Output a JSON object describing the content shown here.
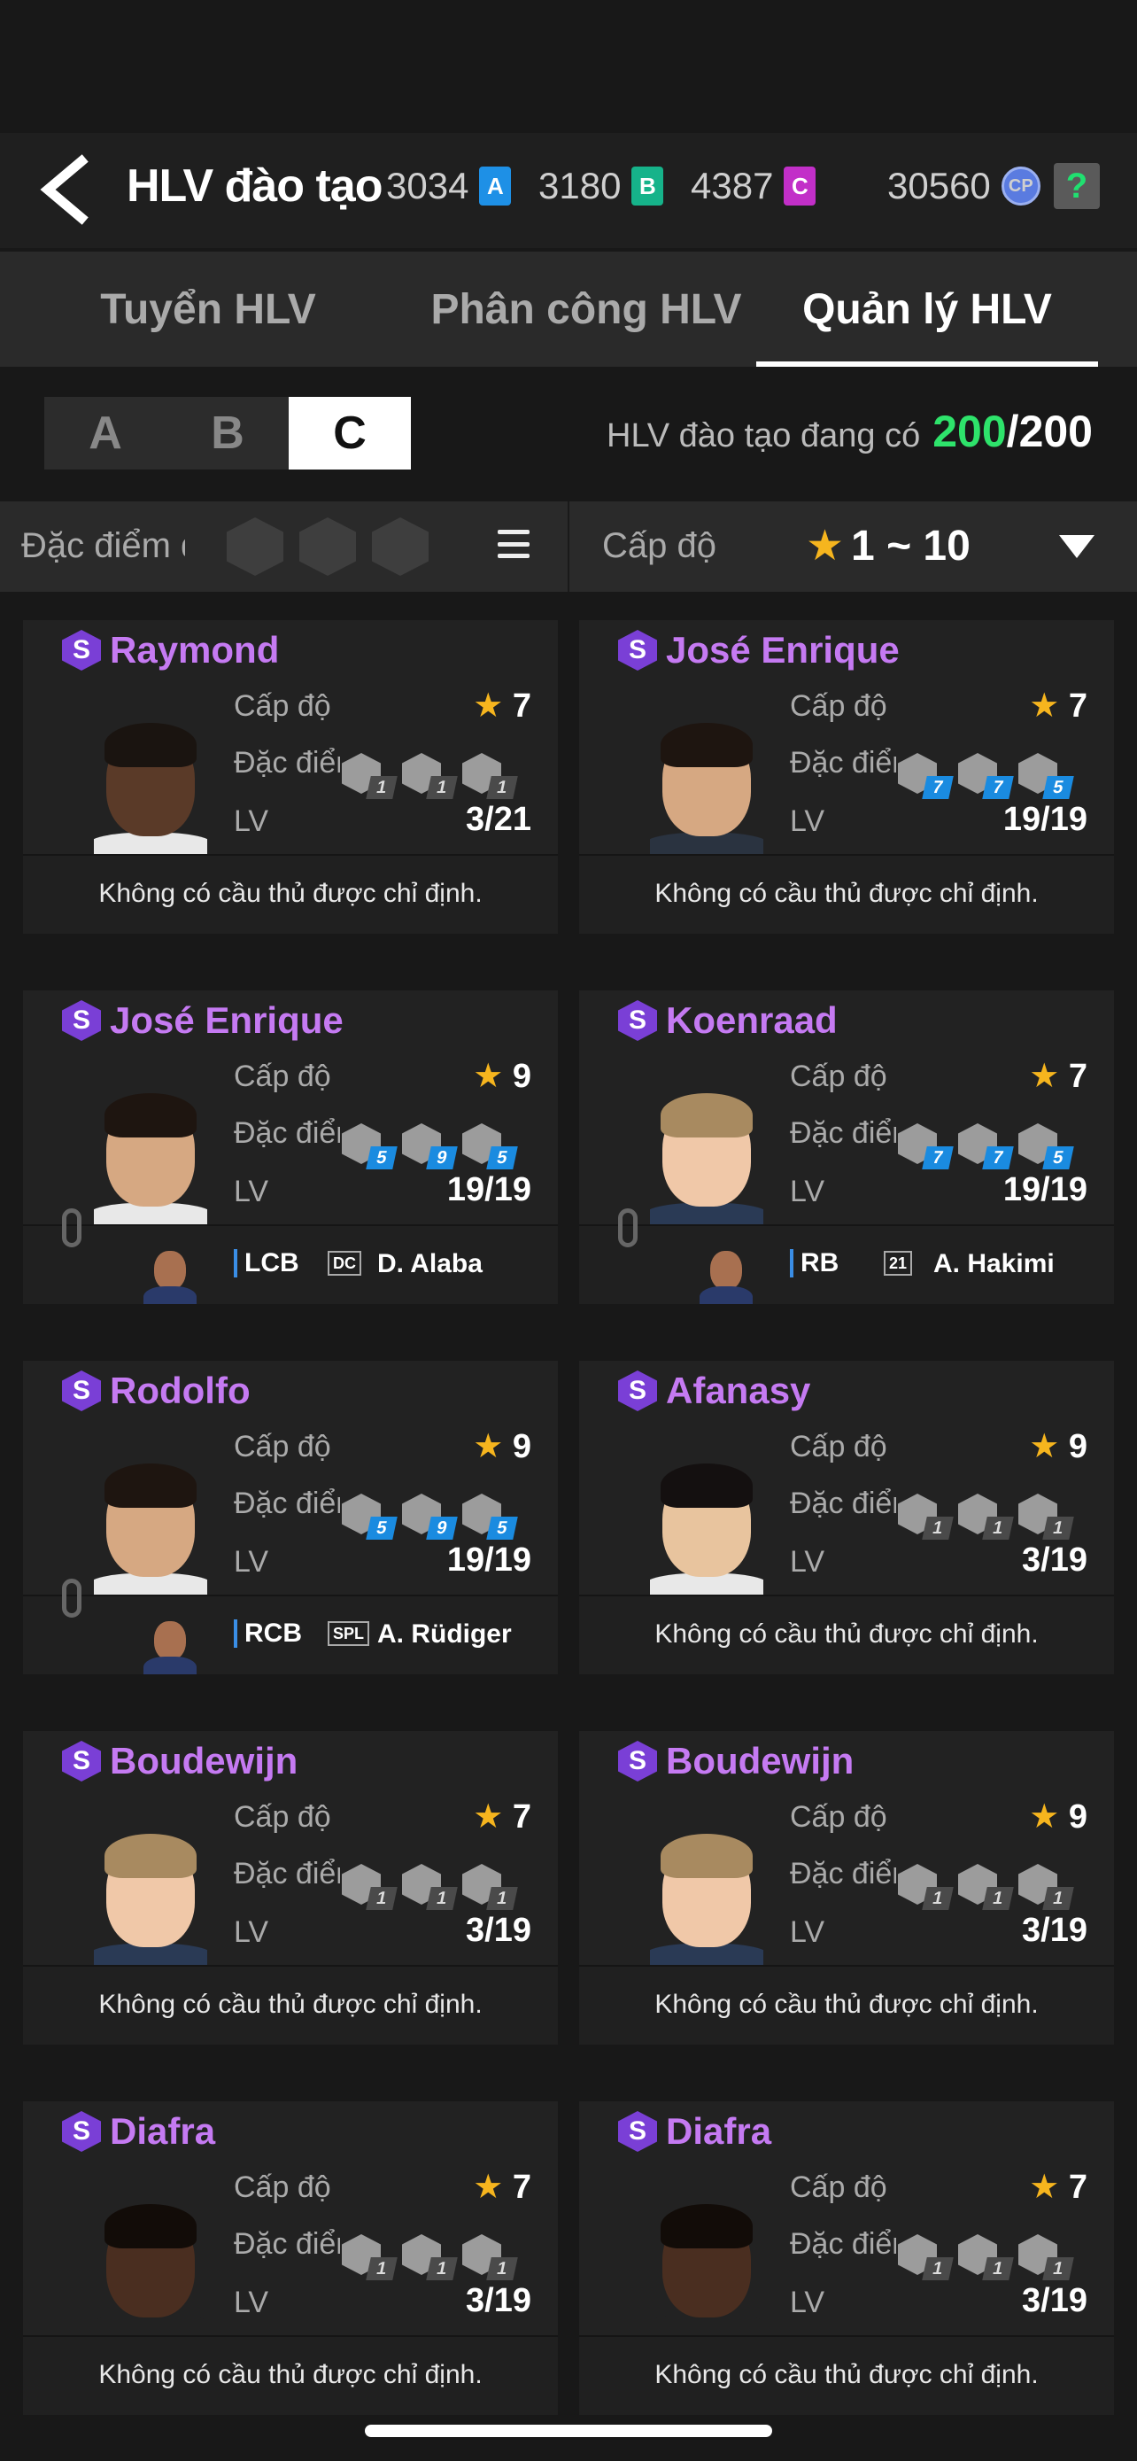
{
  "header": {
    "title": "HLV đào tạo",
    "currencies": [
      {
        "value": "3034",
        "badge": "A",
        "color": "#1e90e6"
      },
      {
        "value": "3180",
        "badge": "B",
        "color": "#16b38a"
      },
      {
        "value": "4387",
        "badge": "C",
        "color": "#c22fc8"
      }
    ],
    "cp_value": "30560",
    "cp_badge": "CP",
    "help_label": "?"
  },
  "tabs": [
    {
      "label": "Tuyển HLV",
      "active": false
    },
    {
      "label": "Phân công HLV",
      "active": false
    },
    {
      "label": "Quản lý HLV",
      "active": true
    }
  ],
  "grades": [
    {
      "label": "A",
      "active": false
    },
    {
      "label": "B",
      "active": false
    },
    {
      "label": "C",
      "active": true
    }
  ],
  "owned": {
    "label": "HLV đào tạo đang có",
    "current": "200",
    "max": "/200"
  },
  "filter": {
    "trait_label": "Đặc điểm đà",
    "level_label": "Cấp độ",
    "level_star": "★",
    "level_range": "1 ~ 10"
  },
  "card_labels": {
    "level": "Cấp độ",
    "trait": "Đặc điểm",
    "lv": "LV",
    "no_player": "Không có cầu thủ được chỉ định."
  },
  "coaches": [
    {
      "name": "Raymond",
      "badge": "S",
      "level": "7",
      "lv": "3/21",
      "traits": [
        "1",
        "1",
        "1"
      ],
      "trait_color": "grey",
      "assigned": null,
      "skin": "#5a3a28",
      "hair": "#1a1410",
      "shirt": "#e8e8e8"
    },
    {
      "name": "José Enrique",
      "badge": "S",
      "level": "7",
      "lv": "19/19",
      "traits": [
        "7",
        "7",
        "5"
      ],
      "trait_color": "blue",
      "assigned": null,
      "skin": "#d6a882",
      "hair": "#1e1510",
      "shirt": "#2a3340"
    },
    {
      "name": "José Enrique",
      "badge": "S",
      "level": "9",
      "lv": "19/19",
      "traits": [
        "5",
        "9",
        "5"
      ],
      "trait_color": "blue",
      "assigned": {
        "pos": "LCB",
        "team": "DC",
        "player": "D. Alaba"
      },
      "skin": "#d6a882",
      "hair": "#1e1510",
      "shirt": "#e8e8e8"
    },
    {
      "name": "Koenraad",
      "badge": "S",
      "level": "7",
      "lv": "19/19",
      "traits": [
        "7",
        "7",
        "5"
      ],
      "trait_color": "blue",
      "assigned": {
        "pos": "RB",
        "team": "21",
        "player": "A. Hakimi"
      },
      "skin": "#f0c8a8",
      "hair": "#a88a60",
      "shirt": "#2a3a55"
    },
    {
      "name": "Rodolfo",
      "badge": "S",
      "level": "9",
      "lv": "19/19",
      "traits": [
        "5",
        "9",
        "5"
      ],
      "trait_color": "blue",
      "assigned": {
        "pos": "RCB",
        "team": "SPL",
        "player": "A. Rüdiger"
      },
      "skin": "#d6a882",
      "hair": "#1e1510",
      "shirt": "#e8e8e8"
    },
    {
      "name": "Afanasy",
      "badge": "S",
      "level": "9",
      "lv": "3/19",
      "traits": [
        "1",
        "1",
        "1"
      ],
      "trait_color": "grey",
      "assigned": null,
      "skin": "#e8c49e",
      "hair": "#141010",
      "shirt": "#e8e8e8"
    },
    {
      "name": "Boudewijn",
      "badge": "S",
      "level": "7",
      "lv": "3/19",
      "traits": [
        "1",
        "1",
        "1"
      ],
      "trait_color": "grey",
      "assigned": null,
      "skin": "#f0c8a8",
      "hair": "#a88a60",
      "shirt": "#2a3a55"
    },
    {
      "name": "Boudewijn",
      "badge": "S",
      "level": "9",
      "lv": "3/19",
      "traits": [
        "1",
        "1",
        "1"
      ],
      "trait_color": "grey",
      "assigned": null,
      "skin": "#f0c8a8",
      "hair": "#a88a60",
      "shirt": "#2a3a55"
    },
    {
      "name": "Diafra",
      "badge": "S",
      "level": "7",
      "lv": "3/19",
      "traits": [
        "1",
        "1",
        "1"
      ],
      "trait_color": "grey",
      "assigned": null,
      "skin": "#4a2e20",
      "hair": "#120c08",
      "shirt": "#222"
    },
    {
      "name": "Diafra",
      "badge": "S",
      "level": "7",
      "lv": "3/19",
      "traits": [
        "1",
        "1",
        "1"
      ],
      "trait_color": "grey",
      "assigned": null,
      "skin": "#4a2e20",
      "hair": "#120c08",
      "shirt": "#222"
    }
  ]
}
